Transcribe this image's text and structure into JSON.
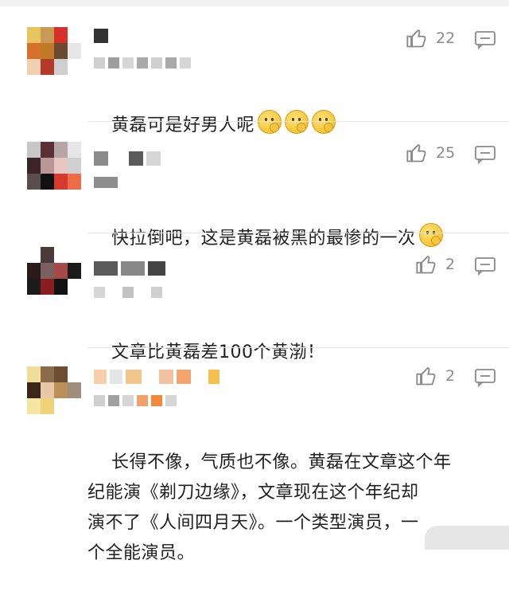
{
  "comments": [
    {
      "likes": "22",
      "text": "黄磊可是好男人呢",
      "emoji_count": 3
    },
    {
      "likes": "25",
      "text": "快拉倒吧，这是黄磊被黑的最惨的一次",
      "emoji_count": 1
    },
    {
      "likes": "2",
      "text": "文章比黄磊差100个黄渤！",
      "emoji_count": 0
    },
    {
      "likes": "2",
      "text": "长得不像，气质也不像。黄磊在文章这个年\n纪能演《剃刀边缘》，文章现在这个年纪却\n演不了《人间四月天》。一个类型演员，一\n个全能演员。",
      "emoji_count": 0
    }
  ],
  "icons": {
    "like": "thumbs-up-icon",
    "reply": "comment-icon",
    "emoji": "thinking-face-emoji-icon"
  },
  "colors": {
    "background": "#ffffff",
    "text": "#1f1f1f",
    "meta": "#8a8a8a",
    "divider": "#e6e6e6"
  }
}
